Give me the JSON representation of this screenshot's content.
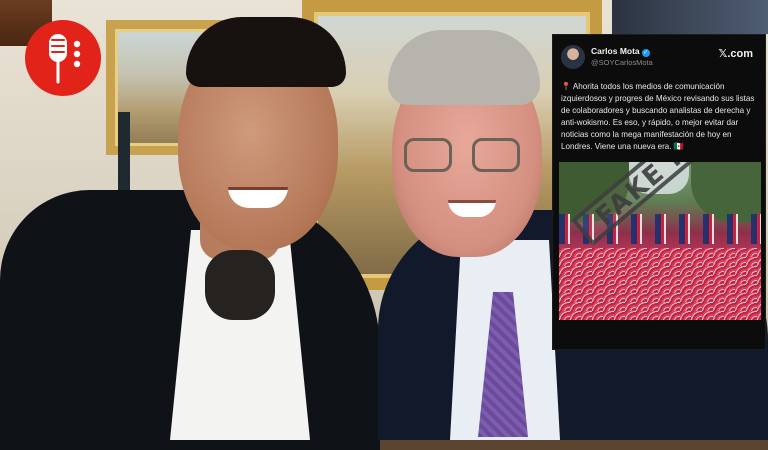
{
  "logo": {
    "icon": "microphone-icon",
    "color": "#e2231a"
  },
  "tweet": {
    "author_name": "Carlos Mota",
    "author_handle": "@SOYCarlosMota",
    "platform": "𝕏.com",
    "pin_icon": "📍",
    "flag_icon": "🇲🇽",
    "body": "Ahorita todos los medios de comunicación izquierdosos y progres de México revisando sus listas de colaboradores y buscando analistas de derecha y anti-wokismo. Es eso, y rápido, o mejor evitar dar noticias como la mega manifestación de hoy en Londres. Viene una nueva era.",
    "image_stamp": "FAKE NEWS",
    "colors": {
      "card_bg": "#0c0c0c",
      "verified": "#1d9bf0"
    }
  }
}
